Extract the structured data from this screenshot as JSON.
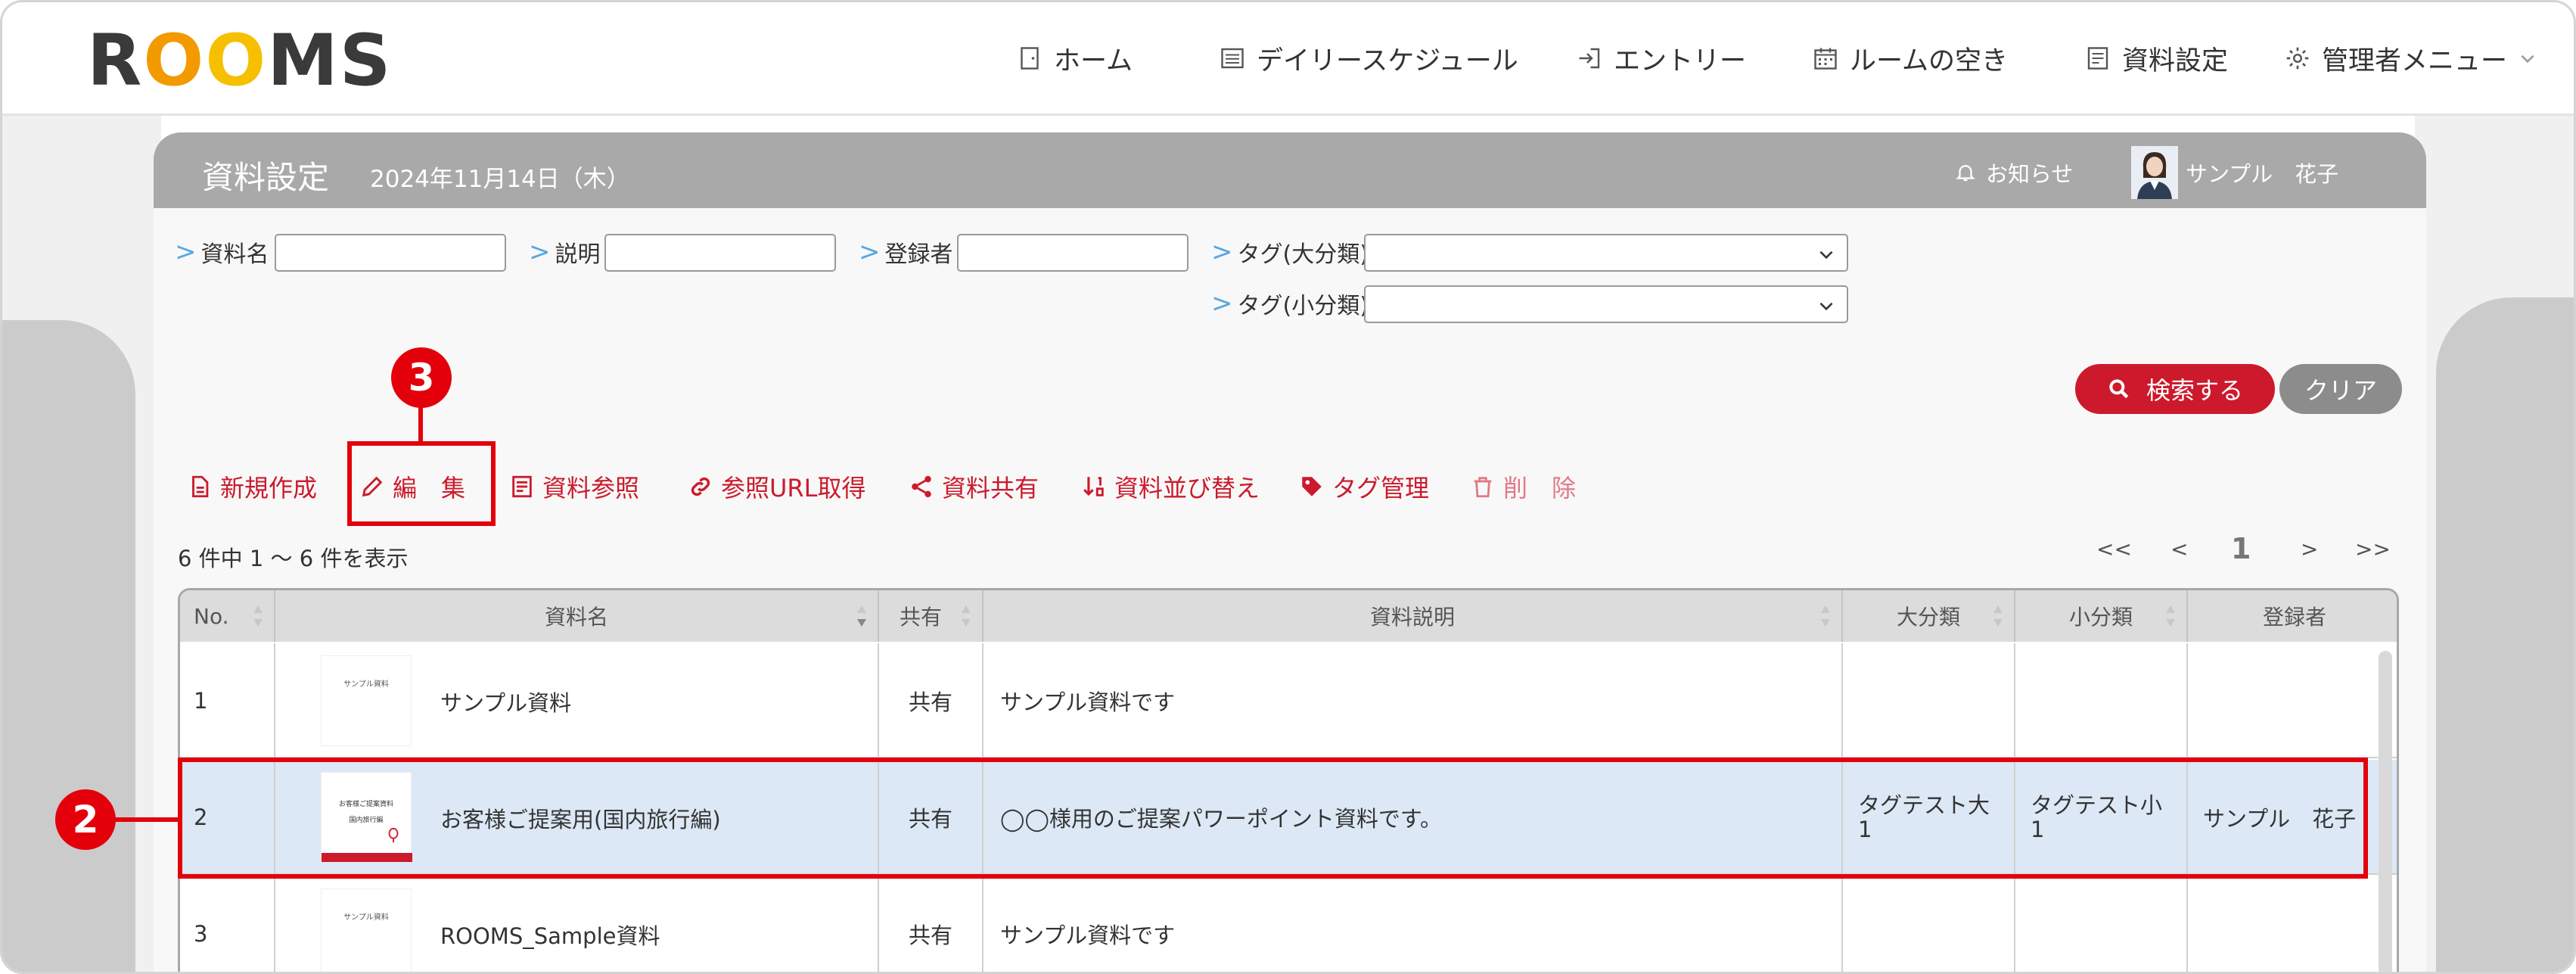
{
  "logo": {
    "text_prefix": "R",
    "text_o1": "O",
    "text_o2": "O",
    "text_suffix": "MS"
  },
  "nav": {
    "home": "ホーム",
    "daily": "デイリースケジュール",
    "entry": "エントリー",
    "rooms": "ルームの空き",
    "docs": "資料設定",
    "admin": "管理者メニュー"
  },
  "panel": {
    "title": "資料設定",
    "date": "2024年11月14日（木）",
    "notice": "お知らせ",
    "user": "サンプル　花子"
  },
  "search": {
    "name_label": "資料名",
    "desc_label": "説明",
    "owner_label": "登録者",
    "tag_major_label": "タグ(大分類)",
    "tag_minor_label": "タグ(小分類)",
    "name_value": "",
    "desc_value": "",
    "owner_value": "",
    "search_button": "検索する",
    "clear_button": "クリア"
  },
  "toolbar": {
    "new": "新規作成",
    "edit": "編　集",
    "view": "資料参照",
    "url": "参照URL取得",
    "share": "資料共有",
    "sort": "資料並び替え",
    "tags": "タグ管理",
    "delete": "削　除"
  },
  "list": {
    "count": "6 件中 1 〜 6 件を表示",
    "pager_first": "<<",
    "pager_prev": "<",
    "pager_current": "1",
    "pager_next": ">",
    "pager_last": ">>"
  },
  "table": {
    "headers": [
      "No.",
      "資料名",
      "共有",
      "資料説明",
      "大分類",
      "小分類",
      "登録者"
    ],
    "rows": [
      {
        "no": "1",
        "name": "サンプル資料",
        "share": "共有",
        "desc": "サンプル資料です",
        "major": "",
        "minor": "",
        "owner": "",
        "thumb_text": "サンプル資料"
      },
      {
        "no": "2",
        "name": "お客様ご提案用(国内旅行編)",
        "share": "共有",
        "desc": "◯◯様用のご提案パワーポイント資料です。",
        "major": "タグテスト大\n1",
        "minor": "タグテスト小\n1",
        "owner": "サンプル　花子",
        "thumb_text": "お客様ご提案資料",
        "thumb_text2": "国内旅行編"
      },
      {
        "no": "3",
        "name": "ROOMS_Sample資料",
        "share": "共有",
        "desc": "サンプル資料です",
        "major": "",
        "minor": "",
        "owner": "",
        "thumb_text": "サンプル資料"
      }
    ]
  },
  "annotations": {
    "step2": "2",
    "step3": "3"
  },
  "colors": {
    "accent": "#cc1a2c",
    "highlight": "#e3000b",
    "selected_row": "#dce8f5",
    "header": "#a9a9a9"
  }
}
